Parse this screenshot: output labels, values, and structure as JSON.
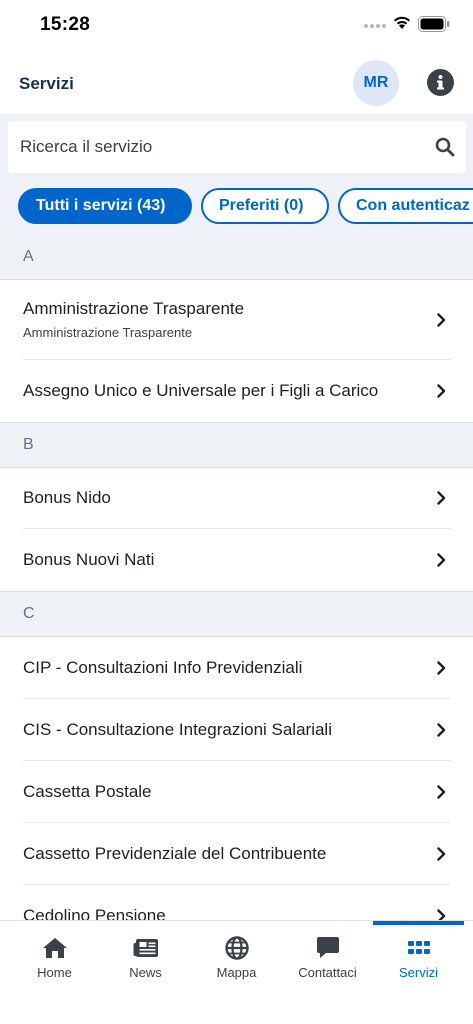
{
  "status_bar": {
    "time": "15:28"
  },
  "header": {
    "title": "Servizi",
    "avatar_initials": "MR"
  },
  "search": {
    "placeholder": "Ricerca il servizio"
  },
  "filters": [
    {
      "label": "Tutti i servizi (43)",
      "active": true
    },
    {
      "label": "Preferiti (0)",
      "active": false
    },
    {
      "label": "Con autenticaz",
      "active": false
    }
  ],
  "sections": [
    {
      "letter": "A",
      "items": [
        {
          "title": "Amministrazione Trasparente",
          "subtitle": "Amministrazione Trasparente"
        },
        {
          "title": "Assegno Unico e Universale per i Figli a Carico"
        }
      ]
    },
    {
      "letter": "B",
      "items": [
        {
          "title": "Bonus Nido"
        },
        {
          "title": "Bonus Nuovi Nati"
        }
      ]
    },
    {
      "letter": "C",
      "items": [
        {
          "title": "CIP - Consultazioni Info Previdenziali"
        },
        {
          "title": "CIS - Consultazione Integrazioni Salariali"
        },
        {
          "title": "Cassetta Postale"
        },
        {
          "title": "Cassetto Previdenziale del Contribuente"
        },
        {
          "title": "Cedolino Pensione"
        }
      ]
    }
  ],
  "tabbar": {
    "items": [
      {
        "label": "Home",
        "icon": "home-icon"
      },
      {
        "label": "News",
        "icon": "news-icon"
      },
      {
        "label": "Mappa",
        "icon": "globe-icon"
      },
      {
        "label": "Contattaci",
        "icon": "chat-icon"
      },
      {
        "label": "Servizi",
        "icon": "grid-icon",
        "active": true
      }
    ]
  },
  "colors": {
    "accent": "#0066cc",
    "title": "#17324d",
    "section_bg": "#eef1f5"
  }
}
